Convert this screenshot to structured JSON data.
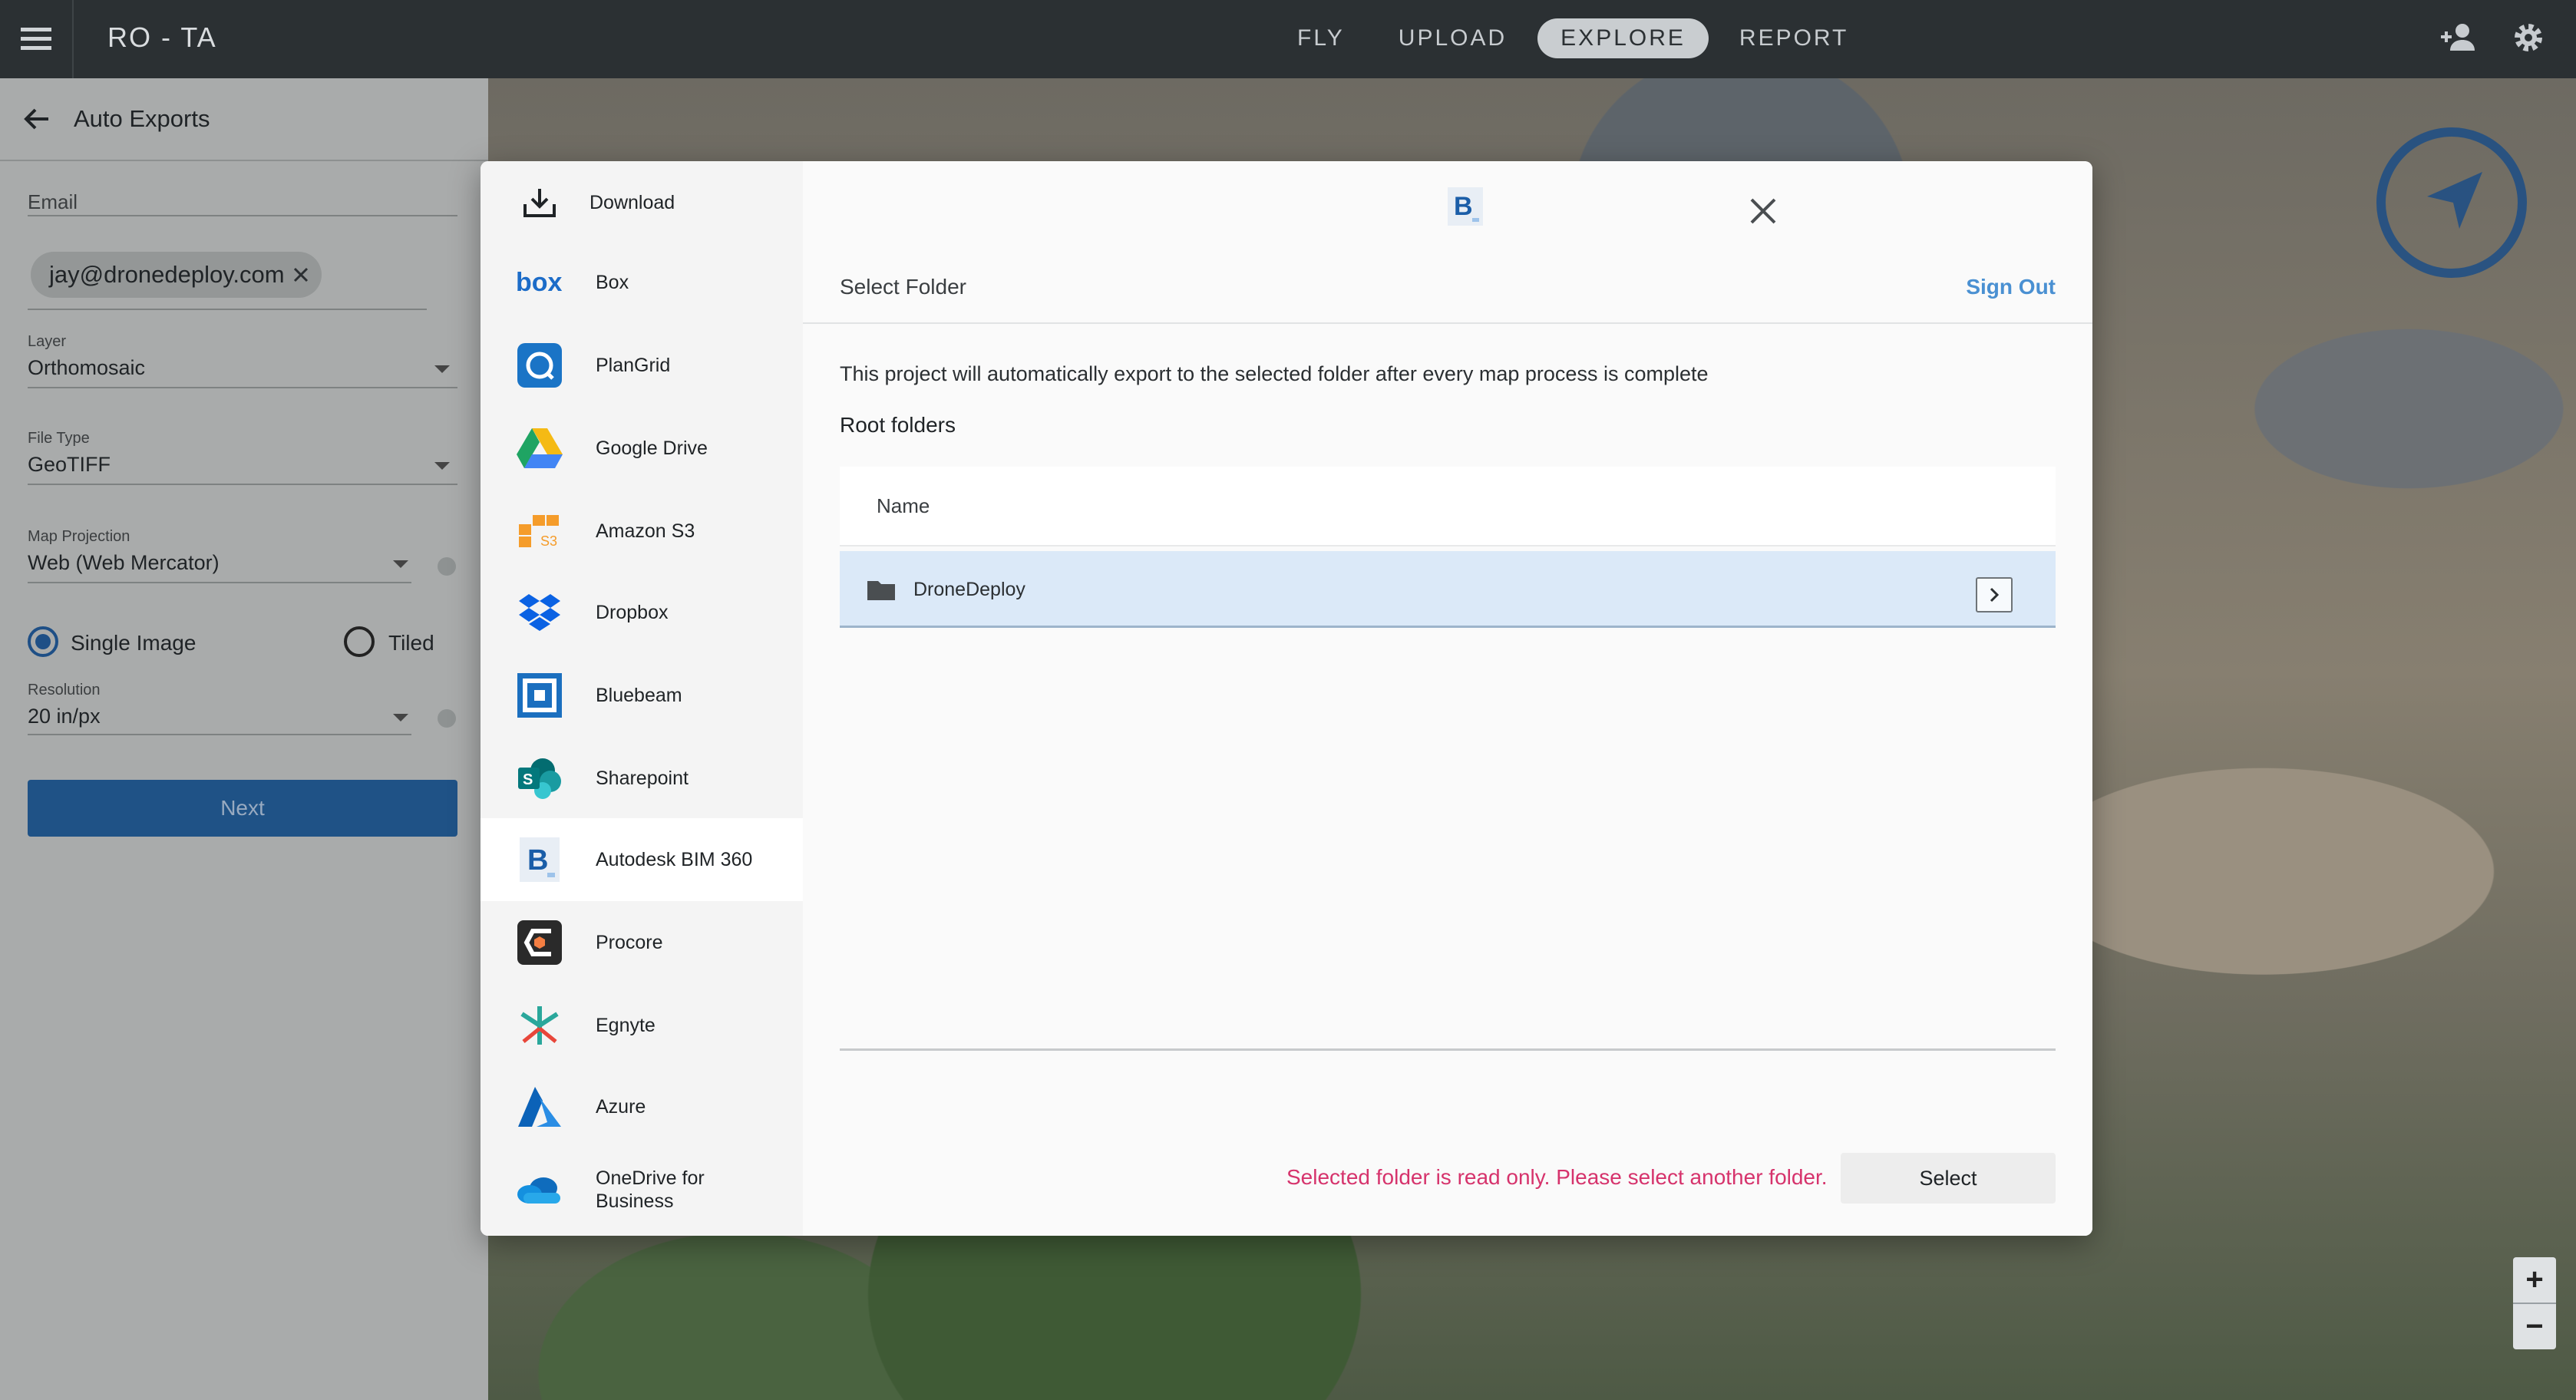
{
  "topbar": {
    "title": "RO - TA",
    "nav": [
      {
        "label": "FLY",
        "active": false
      },
      {
        "label": "UPLOAD",
        "active": false
      },
      {
        "label": "EXPLORE",
        "active": true
      },
      {
        "label": "REPORT",
        "active": false
      }
    ]
  },
  "panel": {
    "title": "Auto Exports",
    "email_label": "Email",
    "email_chip": "jay@dronedeploy.com",
    "layer_label": "Layer",
    "layer_value": "Orthomosaic",
    "filetype_label": "File Type",
    "filetype_value": "GeoTIFF",
    "projection_label": "Map Projection",
    "projection_value": "Web (Web Mercator)",
    "radio_single": "Single Image",
    "radio_tiled": "Tiled",
    "resolution_label": "Resolution",
    "resolution_value": "20 in/px",
    "next_label": "Next"
  },
  "providers": [
    {
      "label": "Download",
      "icon": "download-icon"
    },
    {
      "label": "Box",
      "icon": "box-logo-icon"
    },
    {
      "label": "PlanGrid",
      "icon": "plangrid-logo-icon"
    },
    {
      "label": "Google Drive",
      "icon": "google-drive-logo-icon"
    },
    {
      "label": "Amazon S3",
      "icon": "amazon-s3-logo-icon"
    },
    {
      "label": "Dropbox",
      "icon": "dropbox-logo-icon"
    },
    {
      "label": "Bluebeam",
      "icon": "bluebeam-logo-icon"
    },
    {
      "label": "Sharepoint",
      "icon": "sharepoint-logo-icon"
    },
    {
      "label": "Autodesk BIM 360",
      "icon": "bim360-logo-icon",
      "active": true
    },
    {
      "label": "Procore",
      "icon": "procore-logo-icon"
    },
    {
      "label": "Egnyte",
      "icon": "egnyte-logo-icon"
    },
    {
      "label": "Azure",
      "icon": "azure-logo-icon"
    },
    {
      "label": "OneDrive for Business",
      "icon": "onedrive-logo-icon"
    }
  ],
  "modal": {
    "select_folder": "Select Folder",
    "sign_out": "Sign Out",
    "info": "This project will automatically export to the selected folder after every map process is complete",
    "root_folders": "Root folders",
    "column_name": "Name",
    "rows": [
      {
        "name": "DroneDeploy",
        "icon": "folder-icon",
        "selected": true
      }
    ],
    "error": "Selected folder is read only. Please select another folder.",
    "select_label": "Select"
  },
  "colors": {
    "accent_blue": "#4a90d2",
    "error_pink": "#d6336c",
    "selected_row": "#dbe9f8",
    "next_button": "#1f5286"
  }
}
